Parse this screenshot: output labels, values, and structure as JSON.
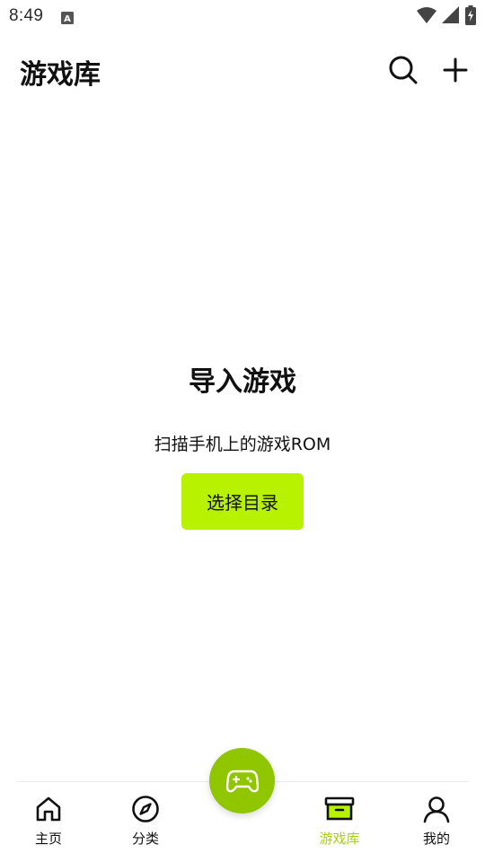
{
  "status_bar": {
    "time": "8:49",
    "icons": [
      "text-a-icon",
      "wifi-icon",
      "signal-icon",
      "battery-charging-icon"
    ]
  },
  "app_bar": {
    "title": "游戏库",
    "actions": [
      "search-icon",
      "plus-icon"
    ]
  },
  "empty_state": {
    "title": "导入游戏",
    "description": "扫描手机上的游戏ROM",
    "button_label": "选择目录"
  },
  "bottom_nav": {
    "items": [
      {
        "label": "主页",
        "icon": "home-icon",
        "active": false
      },
      {
        "label": "分类",
        "icon": "compass-icon",
        "active": false
      },
      {
        "label": "游戏库",
        "icon": "archive-box-icon",
        "active": true
      },
      {
        "label": "我的",
        "icon": "user-icon",
        "active": false
      }
    ],
    "fab_icon": "gamepad-icon"
  },
  "colors": {
    "accent": "#b8f200",
    "active_label": "#a5d500",
    "fab": "#8fc600"
  }
}
